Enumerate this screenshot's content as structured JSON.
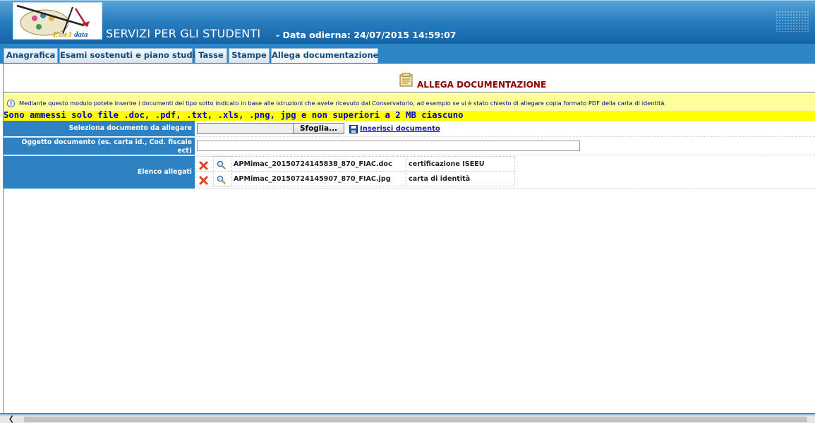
{
  "header": {
    "logo_text": "Esse3 data",
    "app_title": "SERVIZI PER GLI STUDENTI",
    "date_line": "- Data odierna: 24/07/2015 14:59:07"
  },
  "tabs": [
    {
      "label": "Anagrafica"
    },
    {
      "label": "Esami sostenuti e piano studi"
    },
    {
      "label": "Tasse"
    },
    {
      "label": "Stampe"
    },
    {
      "label": "Allega documentazione"
    }
  ],
  "section": {
    "title": "ALLEGA DOCUMENTAZIONE",
    "info": "Mediante questo modulo potete inserire i documenti del tipo sotto indicato in base alle istruzioni che avete ricevuto dal Conservatorio, ad esempio se vi è stato chiesto di allegare copia formato PDF della carta di identità.",
    "warning": "Sono ammessi solo file .doc, .pdf, .txt, .xls, .png, jpg e non superiori a 2 MB ciascuno"
  },
  "form": {
    "select_label": "Seleziona documento da allegare",
    "browse_label": "Sfoglia...",
    "insert_link": "Inserisci documento",
    "subject_label": "Oggetto documento (es. carta id., Cod. fiscale ect)",
    "subject_value": "",
    "list_label": "Elenco allegati"
  },
  "attachments": [
    {
      "file": "APMimac_20150724145838_870_FIAC.doc",
      "description": "certificazione ISEEU"
    },
    {
      "file": "APMimac_20150724145907_870_FIAC.jpg",
      "description": "carta di identità"
    }
  ],
  "colors": {
    "header_blue": "#1463a8",
    "label_blue": "#2e82c2",
    "title_red": "#8b0000",
    "info_yellow": "#ffff99",
    "warning_yellow": "#ffff00",
    "warning_text": "#0000cc"
  },
  "icons": [
    "note-icon",
    "info-icon",
    "save-disk-icon",
    "delete-icon",
    "magnifier-icon",
    "chevron-left-icon"
  ]
}
